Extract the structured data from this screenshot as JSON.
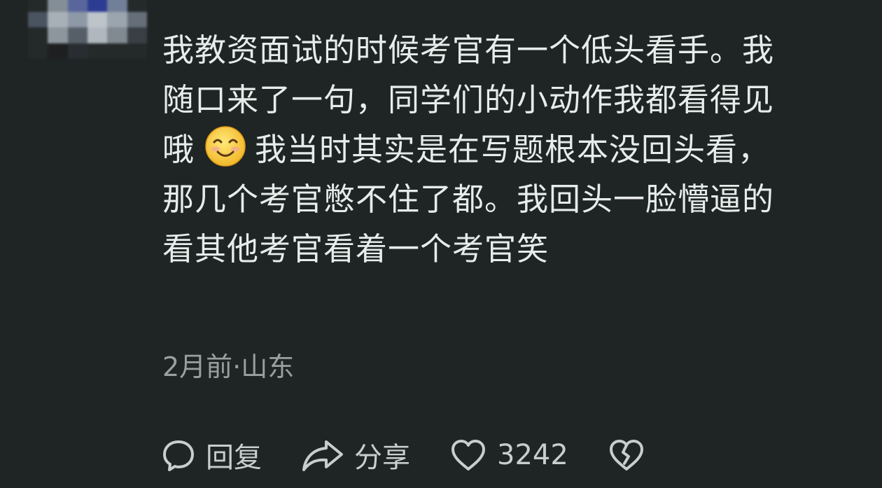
{
  "comment": {
    "lines": [
      "我教资面试的时候考官有一个低头看手。我",
      "随口来了一句，同学们的小动作我都看得见",
      "哦",
      "我当时其实是在写题根本没回头看，",
      "那几个考官憋不住了都。我回头一脸懵逼的",
      "看其他考官看着一个考官笑"
    ],
    "emoji": "smiling-face-icon",
    "meta": "2月前·山东"
  },
  "actions": {
    "reply_label": "回复",
    "share_label": "分享",
    "like_count": "3242"
  },
  "colors": {
    "background": "#1f2424",
    "text": "#e7ebea",
    "meta": "#9aa09f",
    "icon": "#c9cdcc"
  }
}
